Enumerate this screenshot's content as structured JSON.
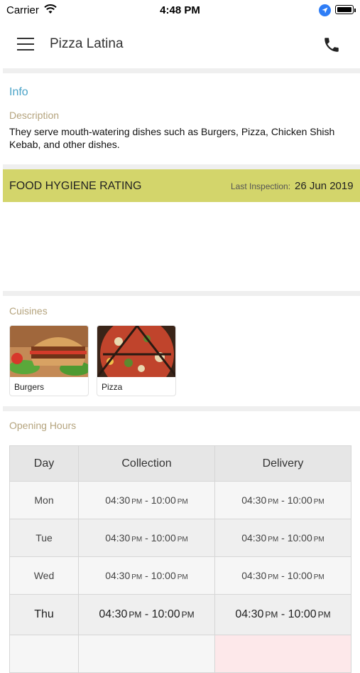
{
  "status": {
    "carrier": "Carrier",
    "time": "4:48 PM"
  },
  "nav": {
    "title": "Pizza Latina",
    "menu_icon": "hamburger-menu-icon",
    "phone_icon": "phone-icon"
  },
  "info": {
    "title": "Info",
    "description_label": "Description",
    "description": "They serve mouth-watering dishes such as Burgers, Pizza, Chicken Shish Kebab,  and other dishes."
  },
  "hygiene": {
    "title": "FOOD HYGIENE RATING",
    "last_inspection_label": "Last Inspection:",
    "last_inspection_date": "26 Jun 2019",
    "bar_color": "#d3d56b"
  },
  "cuisines": {
    "label": "Cuisines",
    "items": [
      {
        "name": "Burgers"
      },
      {
        "name": "Pizza"
      }
    ]
  },
  "opening_hours": {
    "label": "Opening Hours",
    "headers": {
      "day": "Day",
      "collection": "Collection",
      "delivery": "Delivery"
    },
    "rows": [
      {
        "day": "Mon",
        "collection": {
          "from": "04:30",
          "to": "10:00"
        },
        "delivery": {
          "from": "04:30",
          "to": "10:00"
        }
      },
      {
        "day": "Tue",
        "collection": {
          "from": "04:30",
          "to": "10:00"
        },
        "delivery": {
          "from": "04:30",
          "to": "10:00"
        }
      },
      {
        "day": "Wed",
        "collection": {
          "from": "04:30",
          "to": "10:00"
        },
        "delivery": {
          "from": "04:30",
          "to": "10:00"
        }
      },
      {
        "day": "Thu",
        "collection": {
          "from": "04:30",
          "to": "10:00"
        },
        "delivery": {
          "from": "04:30",
          "to": "10:00"
        }
      }
    ],
    "ampm": "PM",
    "separator": " - "
  }
}
